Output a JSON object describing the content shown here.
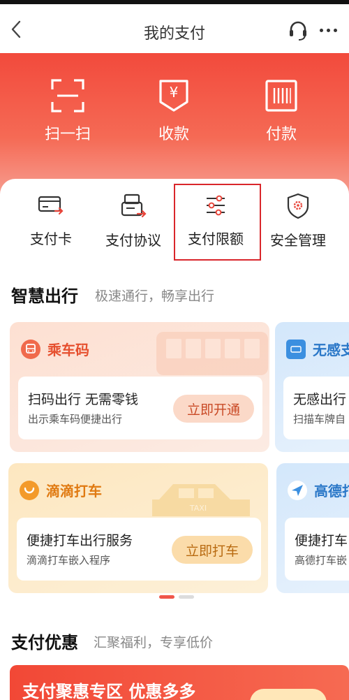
{
  "header": {
    "title": "我的支付"
  },
  "hero": {
    "actions": [
      {
        "label": "扫一扫",
        "icon": "scan-icon"
      },
      {
        "label": "收款",
        "icon": "receive-money-icon"
      },
      {
        "label": "付款",
        "icon": "barcode-pay-icon"
      }
    ]
  },
  "quick_actions": [
    {
      "label": "支付卡",
      "icon": "card-icon"
    },
    {
      "label": "支付协议",
      "icon": "agreement-icon"
    },
    {
      "label": "支付限额",
      "icon": "limit-sliders-icon",
      "highlighted": true
    },
    {
      "label": "安全管理",
      "icon": "shield-gear-icon"
    }
  ],
  "travel": {
    "title": "智慧出行",
    "subtitle": "极速通行，畅享出行",
    "cards": [
      {
        "name": "乘车码",
        "line1": "扫码出行 无需零钱",
        "line2": "出示乘车码便捷出行",
        "button": "立即开通",
        "icon": "bus-icon"
      },
      {
        "name": "无感支",
        "line1": "无感出行",
        "line2": "扫描车牌自",
        "icon": "license-plate-icon"
      },
      {
        "name": "滴滴打车",
        "line1": "便捷打车出行服务",
        "line2": "滴滴打车嵌入程序",
        "button": "立即打车",
        "icon": "didi-icon",
        "bg_text": "TAXI"
      },
      {
        "name": "高德打",
        "line1": "便捷打车",
        "line2": "高德打车嵌",
        "icon": "amap-icon"
      }
    ],
    "pager_active": 0
  },
  "promo": {
    "title": "支付优惠",
    "subtitle": "汇聚福利，专享低价",
    "banner_text": "支付聚惠专区 优惠多多"
  },
  "colors": {
    "accent_red": "#f24a3c",
    "highlight_border": "#d9262b",
    "bus_card_bg": "#fde3d6",
    "taxi_card_bg": "#fdebc8",
    "blue_card_bg": "#d9ebfb"
  }
}
